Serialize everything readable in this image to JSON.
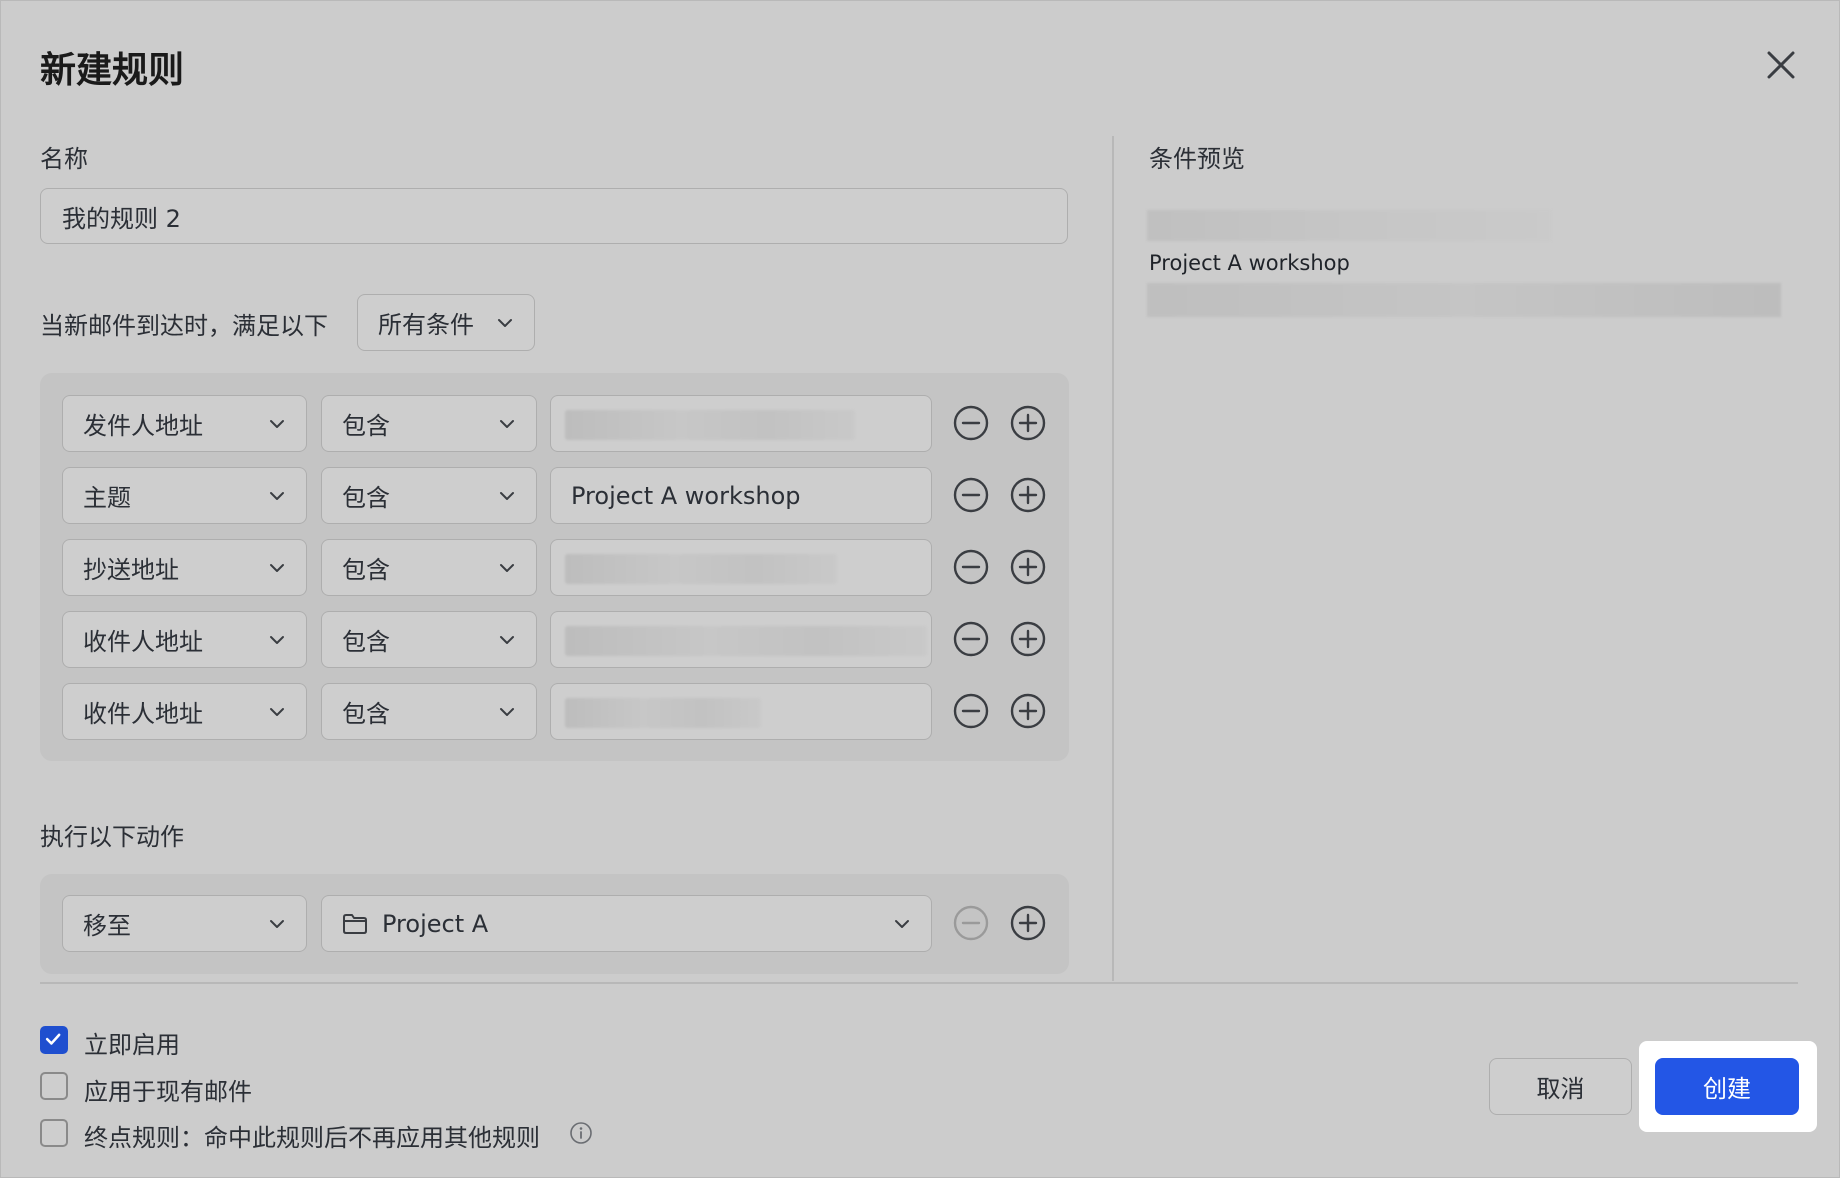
{
  "dialog": {
    "title": "新建规则",
    "name_label": "名称",
    "name_value": "我的规则 2",
    "match_prefix": "当新邮件到达时，满足以下",
    "match_mode": "所有条件",
    "conditions": [
      {
        "field": "发件人地址",
        "operator": "包含",
        "value": ""
      },
      {
        "field": "主题",
        "operator": "包含",
        "value": "Project A workshop"
      },
      {
        "field": "抄送地址",
        "operator": "包含",
        "value": ""
      },
      {
        "field": "收件人地址",
        "operator": "包含",
        "value": ""
      },
      {
        "field": "收件人地址",
        "operator": "包含",
        "value": ""
      }
    ],
    "actions_label": "执行以下动作",
    "action": {
      "type": "移至",
      "destination": "Project A"
    },
    "preview": {
      "title": "条件预览",
      "line": "Project A workshop"
    },
    "options": [
      {
        "label": "立即启用",
        "checked": true
      },
      {
        "label": "应用于现有邮件",
        "checked": false
      },
      {
        "label": "终点规则：命中此规则后不再应用其他规则",
        "checked": false
      }
    ],
    "cancel_label": "取消",
    "create_label": "创建"
  },
  "colors": {
    "accent": "#2356e6",
    "checkbox_on": "#1f4fcf"
  },
  "icons": [
    "close-icon",
    "chevron-down-icon",
    "minus-circle-icon",
    "plus-circle-icon",
    "folder-icon",
    "checkmark-icon",
    "info-icon"
  ]
}
